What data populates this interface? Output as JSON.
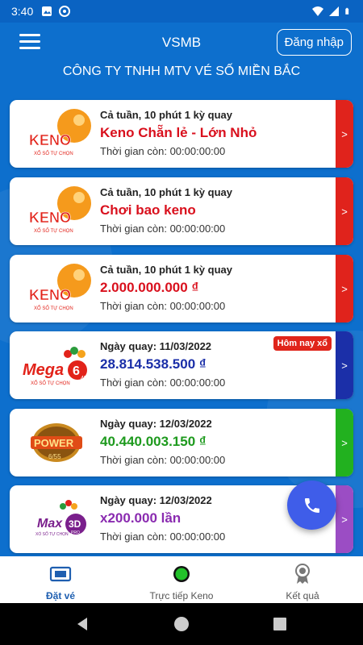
{
  "status_bar": {
    "time": "3:40"
  },
  "header": {
    "title": "VSMB",
    "login_label": "Đăng nhập"
  },
  "company_name": "CÔNG TY TNHH MTV VÉ SỐ MIỀN BẮC",
  "products": [
    {
      "logo": "keno-logo",
      "schedule": "Cả tuần, 10 phút 1 kỳ quay",
      "headline": "Keno Chẵn lẻ - Lớn Nhỏ",
      "headline_color": "#d9101d",
      "countdown": "Thời gian còn: 00:00:00:00",
      "arrow": ">",
      "arrow_color": "#e0231c"
    },
    {
      "logo": "keno-logo",
      "schedule": "Cả tuần, 10 phút 1 kỳ quay",
      "headline": "Chơi bao keno",
      "headline_color": "#d9101d",
      "countdown": "Thời gian còn: 00:00:00:00",
      "arrow": ">",
      "arrow_color": "#e0231c"
    },
    {
      "logo": "keno-logo",
      "schedule": "Cả tuần, 10 phút 1 kỳ quay",
      "headline": "2.000.000.000 ₫",
      "headline_color": "#d9101d",
      "countdown": "Thời gian còn: 00:00:00:00",
      "arrow": ">",
      "arrow_color": "#e0231c"
    },
    {
      "logo": "mega-645-logo",
      "schedule": "Ngày quay: 11/03/2022",
      "headline": "28.814.538.500 ₫",
      "headline_color": "#1a2ea8",
      "countdown": "Thời gian còn: 00:00:00:00",
      "arrow": ">",
      "arrow_color": "#1b2fa8",
      "badge": "Hôm nay xổ"
    },
    {
      "logo": "power-655-logo",
      "schedule": "Ngày quay: 12/03/2022",
      "headline": "40.440.003.150 ₫",
      "headline_color": "#1e9a1e",
      "countdown": "Thời gian còn: 00:00:00:00",
      "arrow": ">",
      "arrow_color": "#22b11f"
    },
    {
      "logo": "max-3d-pro-logo",
      "schedule": "Ngày quay: 12/03/2022",
      "headline": "x200.000 lần",
      "headline_color": "#8a2bb0",
      "countdown": "Thời gian còn: 00:00:00:00",
      "arrow": ">",
      "arrow_color": "#9b4dc4"
    }
  ],
  "logo_text": {
    "keno": "KENO",
    "keno_sub": "XỔ SỐ TỰ CHỌN",
    "mega": "Mega",
    "mega_num": "6",
    "mega_45": "45",
    "mega_sub": "XỔ SỐ TỰ CHỌN",
    "power": "POWER",
    "power_num": "6/55",
    "max": "Max",
    "max_3d": "3D",
    "max_pro": "PRO",
    "max_sub": "XỔ SỐ TỰ CHỌN"
  },
  "bottom_nav": [
    {
      "label": "Đặt vé",
      "icon": "ticket-icon",
      "active": true
    },
    {
      "label": "Trực tiếp Keno",
      "icon": "live-dot-icon",
      "active": false
    },
    {
      "label": "Kết quả",
      "icon": "award-ribbon-icon",
      "active": false
    }
  ],
  "colors": {
    "primary_blue": "#0d6fcd",
    "live_green": "#22c12a",
    "fab_blue": "#3f5de9"
  }
}
